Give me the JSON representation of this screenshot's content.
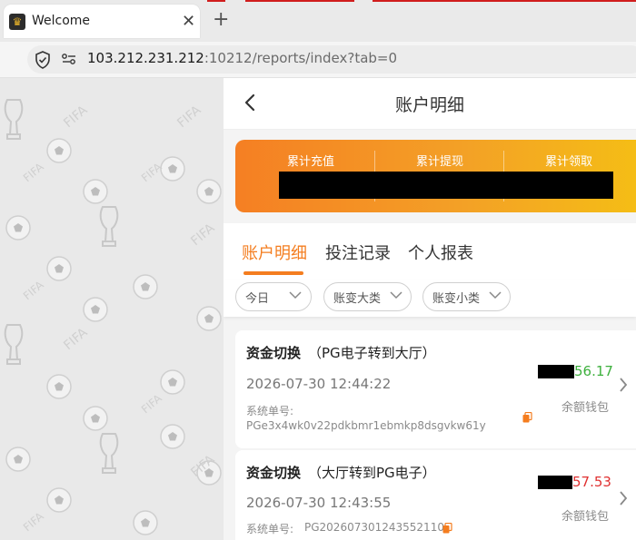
{
  "browser": {
    "tab_title": "Welcome",
    "tab_close": "✕",
    "new_tab": "+",
    "url_host": "103.212.231.212",
    "url_rest": ":10212/reports/index?tab=0"
  },
  "header": {
    "title": "账户明细"
  },
  "summary": {
    "labels": [
      "累计充值",
      "累计提现",
      "累计领取"
    ]
  },
  "tabs": [
    "账户明细",
    "投注记录",
    "个人报表"
  ],
  "filters": [
    "今日",
    "账变大类",
    "账变小类"
  ],
  "records": [
    {
      "type": "资金切换",
      "detail": "（PG电子转到大厅）",
      "time": "2026-07-30 12:44:22",
      "order_label": "系统单号:",
      "order_no": "PGe3x4wk0v22pdkbmr1ebmkp8dsgvkw61y",
      "amount": "56.17",
      "amount_color": "#3db03d",
      "wallet": "余额钱包"
    },
    {
      "type": "资金切换",
      "detail": "（大厅转到PG电子）",
      "time": "2026-07-30 12:43:55",
      "order_label": "系统单号:",
      "order_no": "PG202607301243552110",
      "amount": "57.53",
      "amount_color": "#e03131",
      "wallet": "余额钱包"
    }
  ],
  "colors": {
    "accent": "#f47d1f",
    "gradient_start": "#f57f23",
    "gradient_end": "#f5c014"
  }
}
